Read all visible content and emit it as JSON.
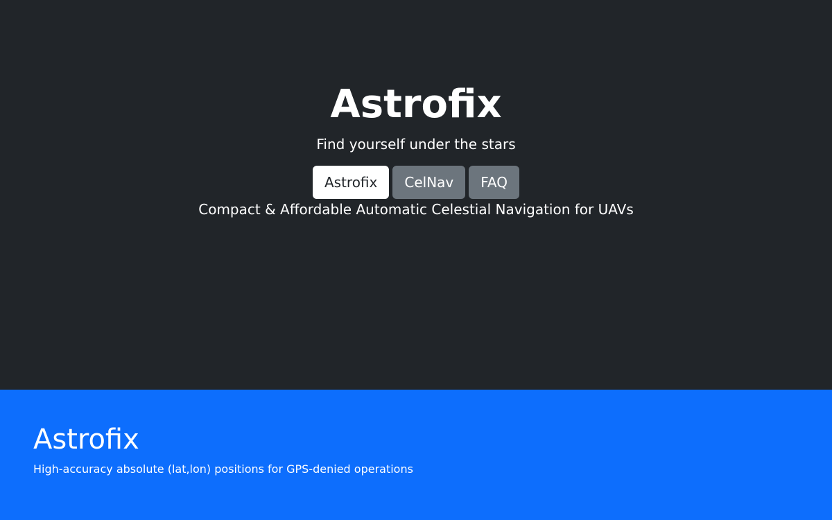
{
  "hero": {
    "title": "Astrofix",
    "tagline": "Find yourself under the stars",
    "description": "Compact & Affordable Automatic Celestial Navigation for UAVs",
    "background_color": "#212529"
  },
  "nav": {
    "items": [
      {
        "label": "Astrofix",
        "active": true
      },
      {
        "label": "CelNav",
        "active": false
      },
      {
        "label": "FAQ",
        "active": false
      }
    ],
    "active_color": "#ffffff",
    "inactive_color": "#6c757d"
  },
  "feature": {
    "title": "Astrofix",
    "subtitle": "High-accuracy absolute (lat,lon) positions for GPS-denied operations",
    "background_color": "#0d6efd"
  }
}
